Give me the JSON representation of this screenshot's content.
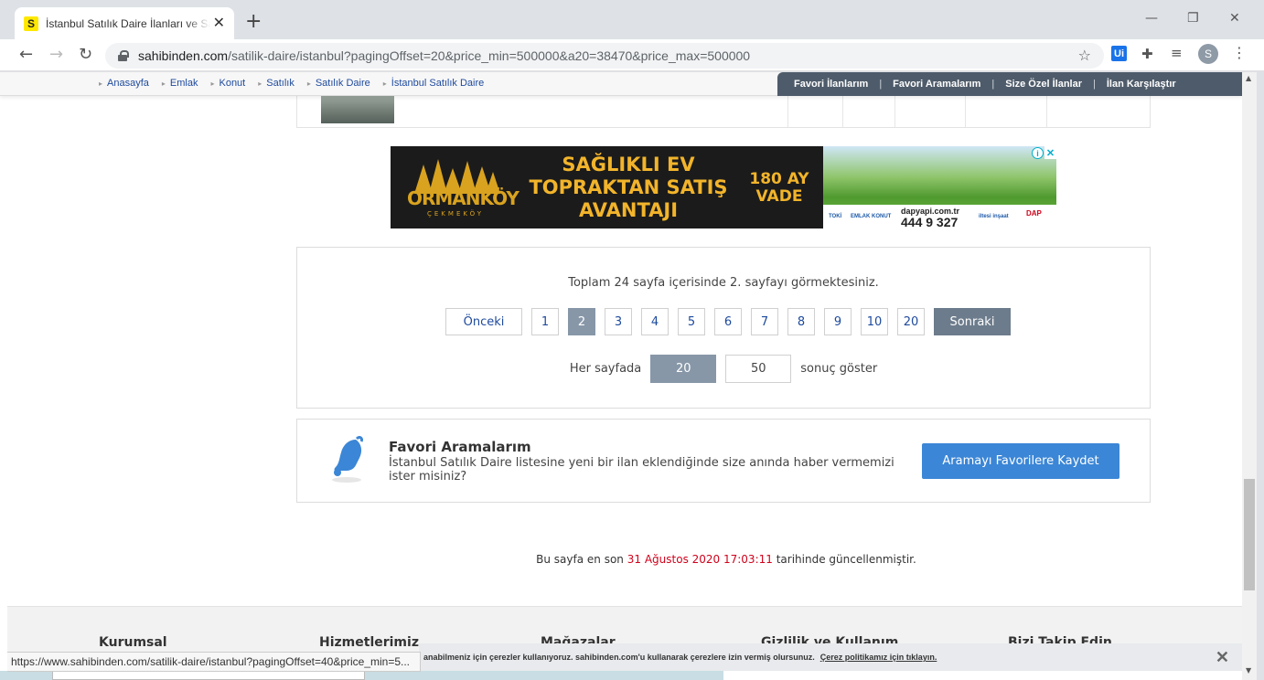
{
  "browser": {
    "tab_title": "İstanbul Satılık Daire İlanları ve Satılık",
    "favicon_letter": "S",
    "url_host": "sahibinden.com",
    "url_path": "/satilik-daire/istanbul?pagingOffset=20&price_min=500000&a20=38470&price_max=500000",
    "extension_label": "Ui",
    "profile_initial": "S"
  },
  "breadcrumbs": [
    "Anasayfa",
    "Emlak",
    "Konut",
    "Satılık",
    "Satılık Daire",
    "İstanbul Satılık Daire"
  ],
  "fav_bar": {
    "items": [
      "Favori İlanlarım",
      "Favori Aramalarım",
      "Size Özel İlanlar",
      "İlan Karşılaştır"
    ]
  },
  "ad": {
    "brand": "ORMANKÖY",
    "brand_sub": "ÇEKMEKÖY",
    "headline": [
      "SAĞLIKLI EV",
      "TOPRAKTAN SATIŞ",
      "AVANTAJI"
    ],
    "term": [
      "180 AY",
      "VADE"
    ],
    "site": "dapyapi.com.tr",
    "phone": "444 9 327",
    "partners": [
      "TOKİ",
      "EMLAK KONUT",
      "iltesi inşaat",
      "DAP"
    ],
    "colors": {
      "gold": "#f2b42b",
      "dark": "#1b1b1b"
    }
  },
  "pagination": {
    "info": "Toplam 24 sayfa içerisinde 2. sayfayı görmektesiniz.",
    "prev_label": "Önceki",
    "next_label": "Sonraki",
    "pages": [
      "1",
      "2",
      "3",
      "4",
      "5",
      "6",
      "7",
      "8",
      "9",
      "10",
      "20"
    ],
    "current_page": "2",
    "per_page_label": "Her sayfada",
    "per_page_options": [
      "20",
      "50"
    ],
    "per_page_selected": "20",
    "per_page_suffix": "sonuç göster"
  },
  "favorite_search": {
    "title": "Favori Aramalarım",
    "description": "İstanbul Satılık Daire listesine yeni bir ilan eklendiğinde size anında haber vermemizi ister misiniz?",
    "button_label": "Aramayı Favorilere Kaydet"
  },
  "updated": {
    "prefix": "Bu sayfa en son",
    "timestamp": "31 Ağustos 2020 17:03:11",
    "suffix": "tarihinde güncellenmiştir."
  },
  "footer": {
    "columns": [
      "Kurumsal",
      "Hizmetlerimiz",
      "Mağazalar",
      "Gizlilik ve Kullanım",
      "Bizi Takip Edin"
    ]
  },
  "cookie": {
    "text": "anabilmeniz için çerezler kullanıyoruz. sahibinden.com'u kullanarak çerezlere izin vermiş olursunuz.",
    "link": "Çerez politikamız için tıklayın."
  },
  "status_url": "https://www.sahibinden.com/satilik-daire/istanbul?pagingOffset=40&price_min=5...",
  "colors": {
    "link": "#1e4a9d",
    "active_page": "#8797a8",
    "next_button": "#6d7c8c",
    "save_button": "#3b86d6",
    "timestamp": "#d0021b"
  }
}
